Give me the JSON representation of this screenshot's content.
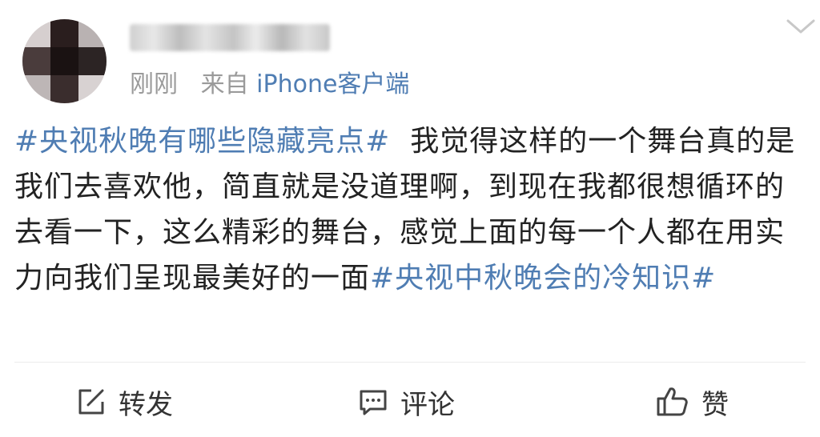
{
  "header": {
    "time": "刚刚",
    "source_prefix": "来自",
    "source_name": "iPhone客户端"
  },
  "post": {
    "segments": [
      {
        "type": "tag",
        "text": "#央视秋晚有哪些隐藏亮点#"
      },
      {
        "type": "text",
        "text": "我觉得这样的一个舞台真的是我们去喜欢他，简直就是没道理啊，到现在我都很想循环的去看一下，这么精彩的舞台，感觉上面的每一个人都在用实力向我们呈现最美好的一面"
      },
      {
        "type": "tag",
        "text": "#央视中秋晚会的冷知识#"
      }
    ]
  },
  "actions": {
    "repost_label": "转发",
    "comment_label": "评论",
    "like_label": "赞"
  },
  "icons": {
    "expand": "chevron-down-icon",
    "repost": "share-edit-icon",
    "comment": "comment-icon",
    "like": "thumbs-up-icon"
  },
  "colors": {
    "link": "#4f7db3",
    "text": "#222222",
    "meta": "#9a9a9a"
  }
}
